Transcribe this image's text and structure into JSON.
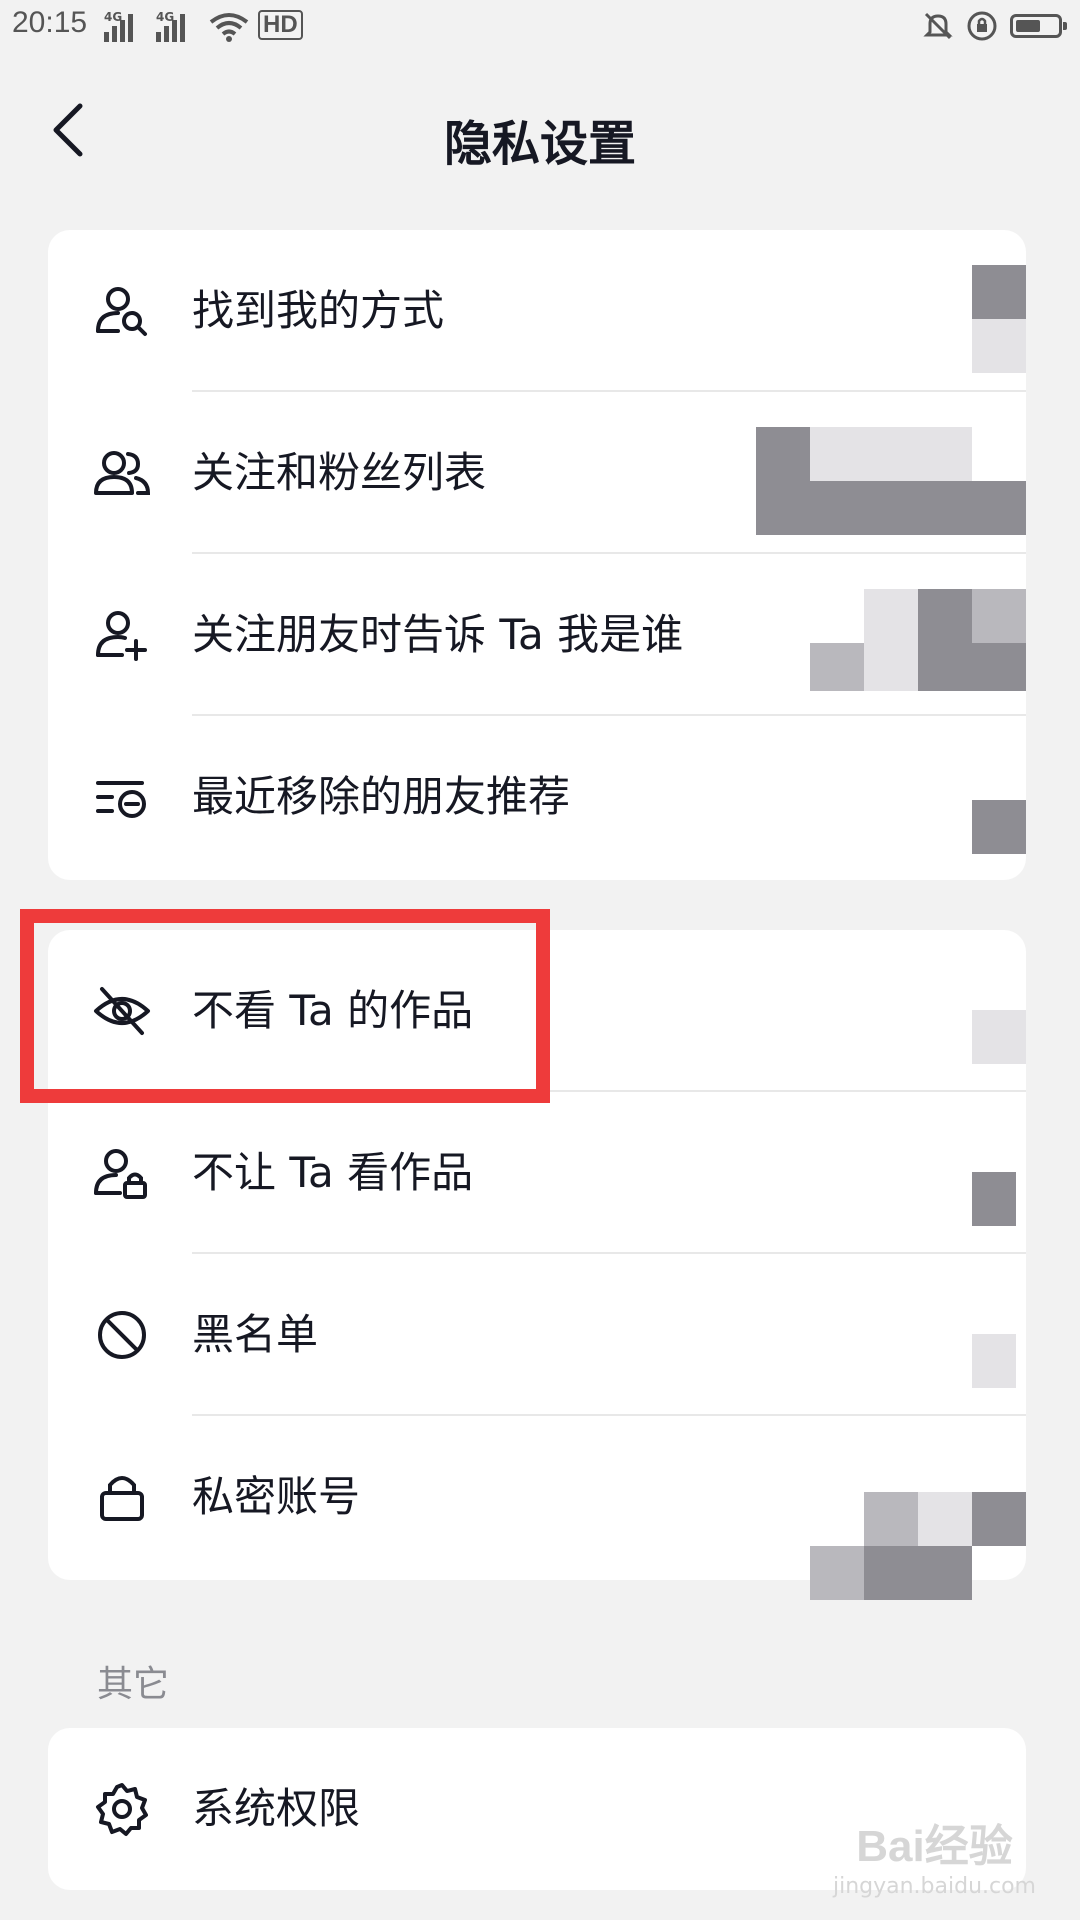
{
  "status_bar": {
    "time": "20:15",
    "network_1": "4G",
    "network_2": "4G",
    "hd_label": "HD",
    "battery_level": 0.6
  },
  "header": {
    "back_icon": "chevron-left-icon",
    "title": "隐私设置"
  },
  "privacy_group_1": {
    "items": [
      {
        "label": "找到我的方式",
        "icon": "person-search-icon"
      },
      {
        "label": "关注和粉丝列表",
        "icon": "people-icon"
      },
      {
        "label": "关注朋友时告诉 Ta 我是谁",
        "icon": "person-add-icon"
      },
      {
        "label": "最近移除的朋友推荐",
        "icon": "list-remove-icon"
      }
    ]
  },
  "privacy_group_2": {
    "items": [
      {
        "label": "不看 Ta 的作品",
        "icon": "eye-off-icon"
      },
      {
        "label": "不让 Ta 看作品",
        "icon": "person-lock-icon"
      },
      {
        "label": "黑名单",
        "icon": "block-icon"
      },
      {
        "label": "私密账号",
        "icon": "lock-icon"
      }
    ]
  },
  "other_section": {
    "label": "其它",
    "items": [
      {
        "label": "系统权限",
        "icon": "gear-icon"
      }
    ]
  },
  "highlight_color": "#ee3b3b",
  "watermark": {
    "line1": "Bai经验",
    "line2": "jingyan.baidu.com"
  }
}
